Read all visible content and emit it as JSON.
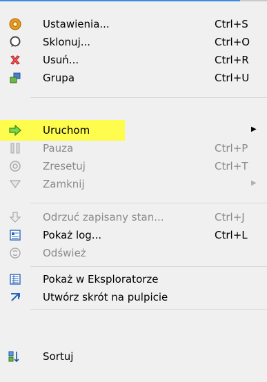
{
  "menu": {
    "items": [
      {
        "label": "Ustawienia...",
        "shortcut": "Ctrl+S",
        "icon": "gear-icon"
      },
      {
        "label": "Sklonuj...",
        "shortcut": "Ctrl+O",
        "icon": "clone-icon"
      },
      {
        "label": "Usuń...",
        "shortcut": "Ctrl+R",
        "icon": "delete-icon"
      },
      {
        "label": "Grupa",
        "shortcut": "Ctrl+U",
        "icon": "group-icon"
      },
      {
        "label": "Uruchom",
        "shortcut": "",
        "icon": "run-arrow-icon"
      },
      {
        "label": "Pauza",
        "shortcut": "Ctrl+P",
        "icon": "pause-icon"
      },
      {
        "label": "Zresetuj",
        "shortcut": "Ctrl+T",
        "icon": "reset-icon"
      },
      {
        "label": "Zamknij",
        "shortcut": "",
        "icon": "close-triangle-icon"
      },
      {
        "label": "Odrzuć zapisany stan...",
        "shortcut": "Ctrl+J",
        "icon": "discard-state-icon"
      },
      {
        "label": "Pokaż log...",
        "shortcut": "Ctrl+L",
        "icon": "log-icon"
      },
      {
        "label": "Odśwież",
        "shortcut": "",
        "icon": "refresh-icon"
      },
      {
        "label": "Pokaż w Eksploratorze",
        "shortcut": "",
        "icon": "explorer-icon"
      },
      {
        "label": "Utwórz skrót na pulpicie",
        "shortcut": "",
        "icon": "shortcut-icon"
      },
      {
        "label": "Sortuj",
        "shortcut": "",
        "icon": "sort-icon"
      }
    ]
  },
  "colors": {
    "highlight": "#fffd3a",
    "accent": "#3d8ce0",
    "disabled_text": "#8a8a8a"
  }
}
